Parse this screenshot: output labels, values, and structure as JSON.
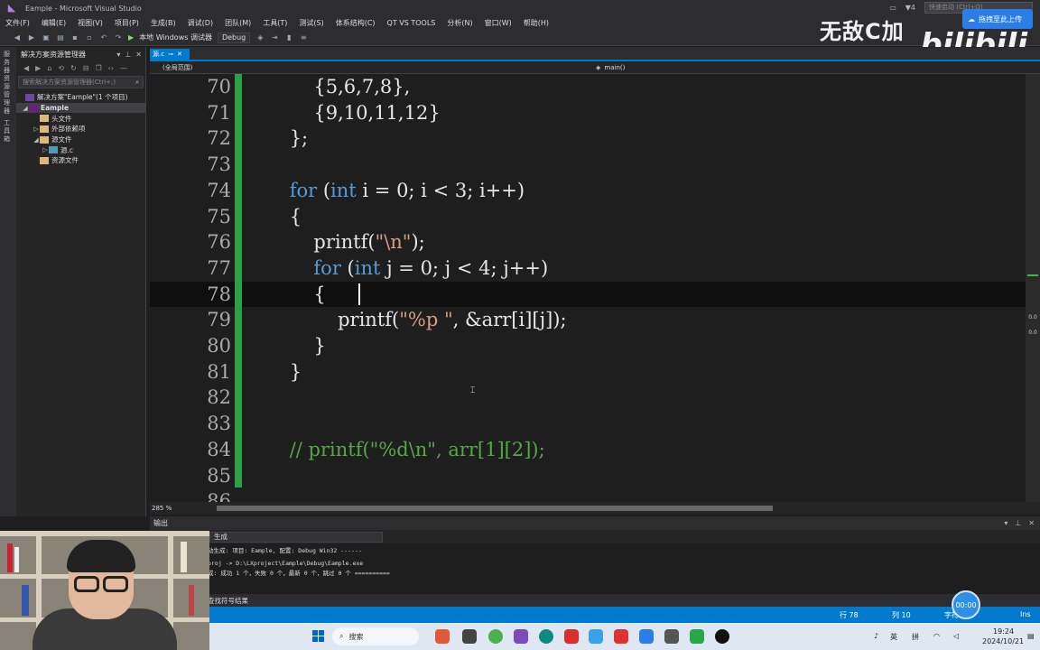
{
  "window": {
    "title": "Eample - Microsoft Visual Studio"
  },
  "titlebar": {
    "notify_count": "4",
    "quick_launch_placeholder": "快速启动 (Ctrl+Q)"
  },
  "menu": [
    "文件(F)",
    "编辑(E)",
    "视图(V)",
    "项目(P)",
    "生成(B)",
    "调试(D)",
    "团队(M)",
    "工具(T)",
    "测试(S)",
    "体系结构(C)",
    "QT VS TOOLS",
    "分析(N)",
    "窗口(W)",
    "帮助(H)"
  ],
  "toolbar": {
    "run_label": "本地 Windows 调试器",
    "config": "Debug"
  },
  "overlay": {
    "channel": "无敌C加加",
    "site_logo": "bilibili",
    "upload_label": "拖拽至此上传"
  },
  "left_strip": {
    "tab1": "服务器资源管理器",
    "tab2": "工具箱"
  },
  "solution_explorer": {
    "title": "解决方案资源管理器",
    "search_placeholder": "搜索解决方案资源管理器(Ctrl+;)",
    "items": [
      {
        "label": "解决方案\"Eample\"(1 个项目)",
        "icon": "solution-icon"
      },
      {
        "label": "Eample",
        "icon": "project-icon"
      },
      {
        "label": "头文件",
        "icon": "folder-icon"
      },
      {
        "label": "外部依赖项",
        "icon": "folder-icon"
      },
      {
        "label": "源文件",
        "icon": "folder-icon"
      },
      {
        "label": "源.c",
        "icon": "c-file-icon"
      },
      {
        "label": "资源文件",
        "icon": "folder-icon"
      }
    ]
  },
  "document_tab": {
    "label": "源.c"
  },
  "navbar": {
    "scope": "(全局范围)",
    "function": "main()"
  },
  "editor": {
    "lines": [
      {
        "n": "70",
        "code": "        {5,6,7,8},",
        "kind": "plain"
      },
      {
        "n": "71",
        "code": "        {9,10,11,12}",
        "kind": "plain"
      },
      {
        "n": "72",
        "code": "    };",
        "kind": "plain"
      },
      {
        "n": "73",
        "code": "",
        "kind": "plain"
      },
      {
        "n": "74",
        "kind": "for_i"
      },
      {
        "n": "75",
        "code": "    {",
        "kind": "plain"
      },
      {
        "n": "76",
        "kind": "printf_n"
      },
      {
        "n": "77",
        "kind": "for_j"
      },
      {
        "n": "78",
        "code": "        {",
        "kind": "current"
      },
      {
        "n": "79",
        "kind": "printf_p"
      },
      {
        "n": "80",
        "code": "        }",
        "kind": "plain"
      },
      {
        "n": "81",
        "code": "    }",
        "kind": "plain"
      },
      {
        "n": "82",
        "code": "",
        "kind": "plain"
      },
      {
        "n": "83",
        "code": "",
        "kind": "plain"
      },
      {
        "n": "84",
        "code": "    // printf(\"%d\\n\", arr[1][2]);",
        "kind": "comment"
      },
      {
        "n": "85",
        "code": "",
        "kind": "plain"
      },
      {
        "n": "86",
        "code": "",
        "kind": "plain"
      }
    ],
    "tokens": {
      "for_i": {
        "indent": "    ",
        "kw1": "for",
        "p1": " (",
        "kw2": "int",
        "rest": " i = 0; i < 3; i++)"
      },
      "for_j": {
        "indent": "        ",
        "kw1": "for",
        "p1": " (",
        "kw2": "int",
        "rest": " j = 0; j < 4; j++)"
      },
      "printf_n": {
        "indent": "        ",
        "pre": "printf(",
        "str": "\"\\n\"",
        "post": ");"
      },
      "printf_p": {
        "indent": "            ",
        "pre": "printf(",
        "str": "\"%p \"",
        "post": ", &arr[i][j]);"
      }
    }
  },
  "scroll_labels": [
    "0.0",
    "0.0"
  ],
  "zoom": "285 %",
  "output": {
    "title": "输出",
    "source": "生成",
    "lines": [
      "1>------ 已启动生成: 项目: Eample, 配置: Debug Win32 ------",
      "1>Eample.vcxproj -> D:\\LXproject\\Eample\\Debug\\Eample.exe",
      "========== 生成: 成功 1 个，失败 0 个，最新 0 个，跳过 0 个 =========="
    ],
    "visible_lines": [
      "动生成: 项目: Eample, 配置: Debug Win32 ------",
      "proj -> D:\\LXproject\\Eample\\Debug\\Eample.exe",
      "成: 成功 1 个，失败 0 个，最新 0 个，跳过 0 个 =========="
    ],
    "bottom_tab": "查找符号结果"
  },
  "statusbar": {
    "row": "行 78",
    "col": "列 10",
    "char": "字符",
    "mode": "Ins",
    "rec_time": "00:00"
  },
  "taskbar": {
    "search_label": "搜索",
    "ime1": "英",
    "ime2": "拼",
    "time": "19:24",
    "date": "2024/10/21"
  },
  "colors": {
    "accent": "#007acc",
    "keyword": "#569cd6",
    "string": "#d69d85",
    "comment": "#57a64a",
    "changebar": "#2ea043"
  }
}
